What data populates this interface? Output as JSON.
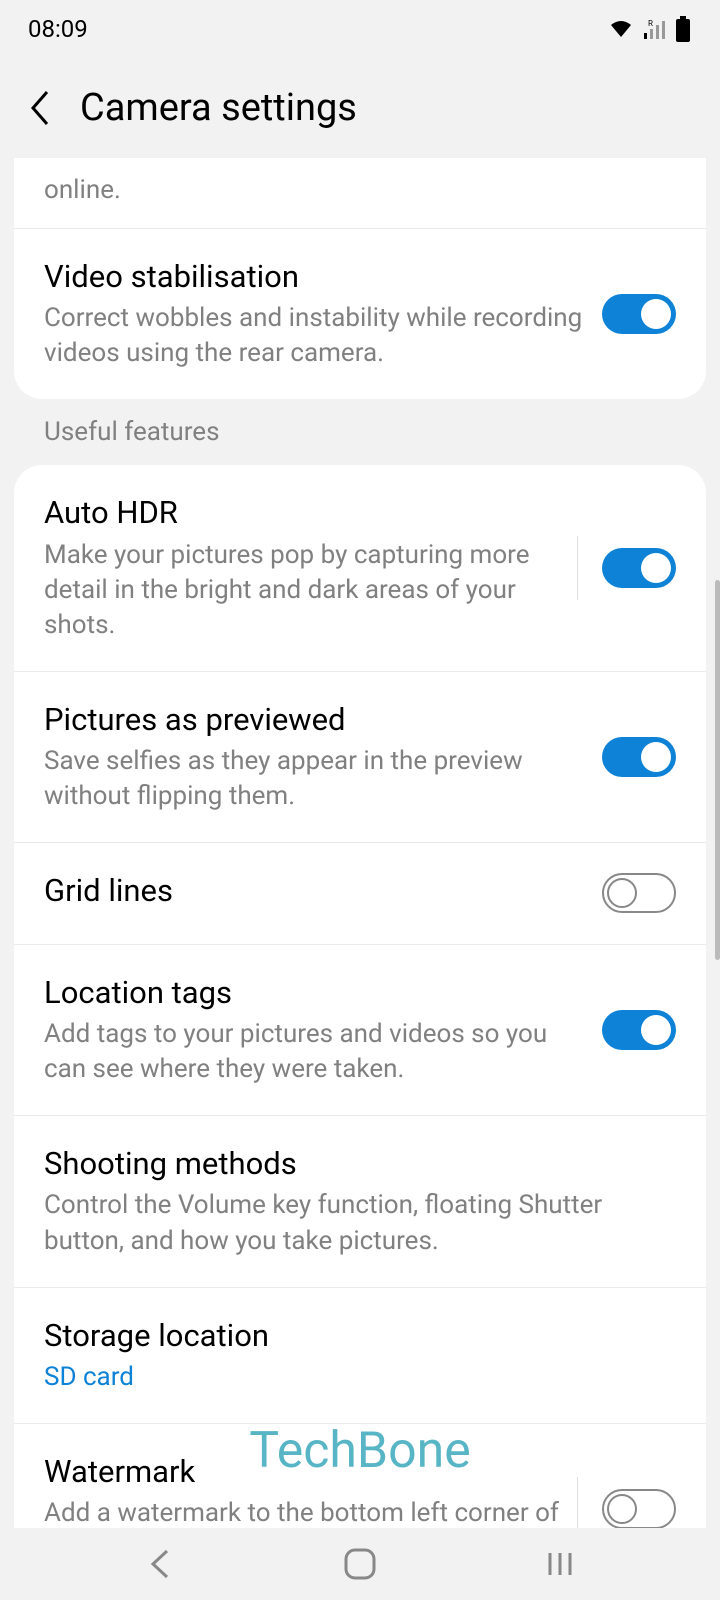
{
  "status": {
    "time": "08:09"
  },
  "header": {
    "title": "Camera settings"
  },
  "truncated_top": "online.",
  "section_useful": "Useful features",
  "settings": {
    "video_stab": {
      "title": "Video stabilisation",
      "desc": "Correct wobbles and instability while recording videos using the rear camera.",
      "enabled": true
    },
    "auto_hdr": {
      "title": "Auto HDR",
      "desc": "Make your pictures pop by capturing more detail in the bright and dark areas of your shots.",
      "enabled": true
    },
    "pictures_preview": {
      "title": "Pictures as previewed",
      "desc": "Save selfies as they appear in the preview without flipping them.",
      "enabled": true
    },
    "grid_lines": {
      "title": "Grid lines",
      "enabled": false
    },
    "location_tags": {
      "title": "Location tags",
      "desc": "Add tags to your pictures and videos so you can see where they were taken.",
      "enabled": true
    },
    "shooting_methods": {
      "title": "Shooting methods",
      "desc": "Control the Volume key function, floating Shutter button, and how you take pictures."
    },
    "storage_location": {
      "title": "Storage location",
      "value": "SD card"
    },
    "watermark": {
      "title": "Watermark",
      "desc": "Add a watermark to the bottom left corner of your pictures.",
      "enabled": false
    }
  },
  "overlay": "TechBone"
}
